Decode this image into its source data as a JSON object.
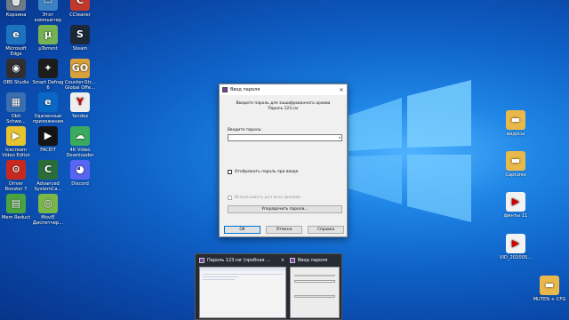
{
  "desktop": {
    "left_icons": [
      {
        "label": "Корзина",
        "color": "#6e7b8a",
        "glyph": "🗑"
      },
      {
        "label": "Этот\nкомпьютер",
        "color": "#3b82c4",
        "glyph": "▭"
      },
      {
        "label": "CCleaner",
        "color": "#c0392b",
        "glyph": "C"
      },
      {
        "label": "Microsoft\nEdge",
        "color": "#1e73be",
        "glyph": "e"
      },
      {
        "label": "µTorrent",
        "color": "#77b255",
        "glyph": "µ"
      },
      {
        "label": "Steam",
        "color": "#1b2838",
        "glyph": "S"
      },
      {
        "label": "OBS Studio",
        "color": "#302e31",
        "glyph": "◉"
      },
      {
        "label": "Smart Defrag\n6",
        "color": "#1c1c1c",
        "glyph": "✦"
      },
      {
        "label": "Counter-Str...\nGlobal Offe...",
        "color": "#d9a13b",
        "glyph": "GO"
      },
      {
        "label": "Obit\nSchwe...",
        "color": "#3a6fb0",
        "glyph": "▦"
      },
      {
        "label": "Удаленные\nприложения",
        "color": "#0a68c5",
        "glyph": "e"
      },
      {
        "label": "Yandex",
        "color": "#eeeeee",
        "glyph": "Y"
      },
      {
        "label": "Icecream\nVideo Editor",
        "color": "#e6c431",
        "glyph": "▶"
      },
      {
        "label": "FACEIT",
        "color": "#151515",
        "glyph": "▶"
      },
      {
        "label": "4K Video\nDownloader",
        "color": "#3aaa5c",
        "glyph": "☁"
      },
      {
        "label": "Driver\nBooster 7",
        "color": "#c8291e",
        "glyph": "⚙"
      },
      {
        "label": "Advanced\nSystemCa...",
        "color": "#2b6d3a",
        "glyph": "C"
      },
      {
        "label": "Discord",
        "color": "#5865f2",
        "glyph": "◕"
      },
      {
        "label": "Mem Reduct",
        "color": "#4aa340",
        "glyph": "▤"
      },
      {
        "label": "MoviE\nДиспетчер...",
        "color": "#7ab648",
        "glyph": "◎"
      }
    ],
    "right_icons": [
      {
        "label": "видосы",
        "color": "#e8b84a",
        "glyph": "▬"
      },
      {
        "label": "Captures",
        "color": "#e8b84a",
        "glyph": "▬"
      },
      {
        "label": "финты 11",
        "color": "#f2f2f2",
        "glyph": "▶"
      },
      {
        "label": "VID_202005...",
        "color": "#f2f2f2",
        "glyph": "▶"
      },
      {
        "label": "MUTEN + CFG",
        "color": "#e8b84a",
        "glyph": "▬"
      }
    ]
  },
  "dialog": {
    "title": "Ввод пароля",
    "close": "×",
    "description": "Введите пароль для зашифрованного архива\nПароль 123.rar",
    "password_label": "Введите пароль:",
    "password_value": "",
    "show_password_label": "Отображать пароль при вводе",
    "use_for_all_label": "Использовать для всех архивов",
    "organize_button": "Упорядочить пароли...",
    "ok_button": "OK",
    "cancel_button": "Отмена",
    "help_button": "Справка"
  },
  "taskbar_preview": {
    "items": [
      {
        "title": "Пароль 123.rar (пробная ...",
        "close": "×"
      },
      {
        "title": "Ввод пароля",
        "close": ""
      }
    ]
  }
}
